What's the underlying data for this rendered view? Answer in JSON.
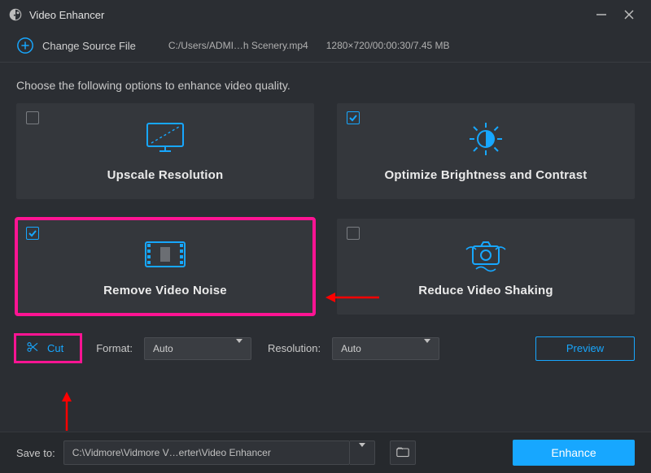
{
  "titlebar": {
    "title": "Video Enhancer"
  },
  "source": {
    "change_label": "Change Source File",
    "path": "C:/Users/ADMI…h Scenery.mp4",
    "meta": "1280×720/00:00:30/7.45 MB"
  },
  "instruction": "Choose the following options to enhance video quality.",
  "options": {
    "upscale": {
      "label": "Upscale Resolution",
      "checked": false
    },
    "brightness": {
      "label": "Optimize Brightness and Contrast",
      "checked": true
    },
    "denoise": {
      "label": "Remove Video Noise",
      "checked": true
    },
    "deshake": {
      "label": "Reduce Video Shaking",
      "checked": false
    }
  },
  "row2": {
    "cut_label": "Cut",
    "format_label": "Format:",
    "format_value": "Auto",
    "resolution_label": "Resolution:",
    "resolution_value": "Auto",
    "preview_label": "Preview"
  },
  "footer": {
    "save_label": "Save to:",
    "path": "C:\\Vidmore\\Vidmore V…erter\\Video Enhancer",
    "enhance_label": "Enhance"
  },
  "colors": {
    "accent": "#17a7ff",
    "highlight": "#ff1493"
  }
}
